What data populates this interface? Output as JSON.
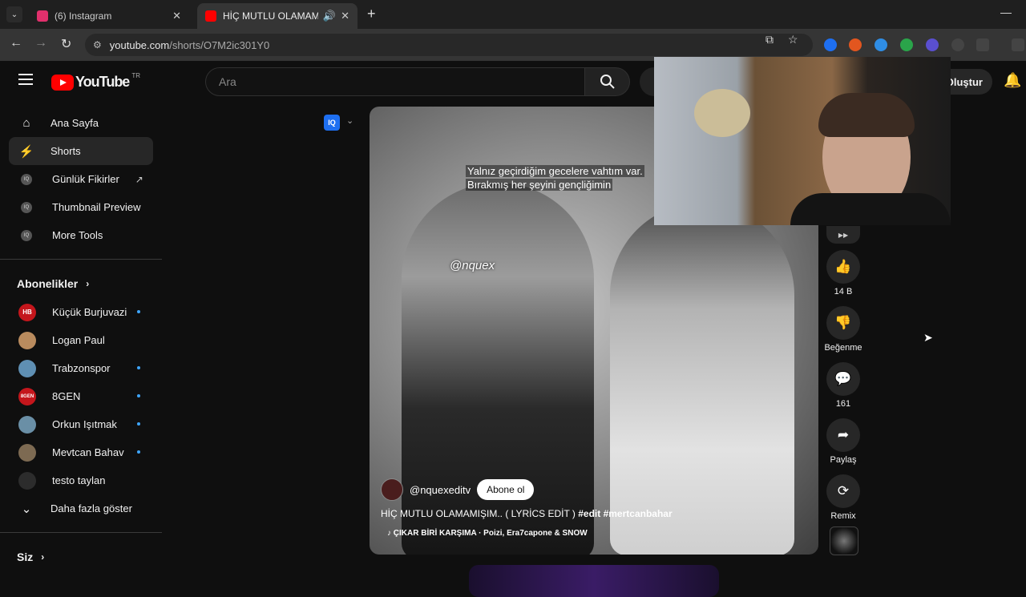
{
  "browser": {
    "tabs": [
      {
        "title": "(6) Instagram",
        "active": false,
        "favicon_color": "#e1306c"
      },
      {
        "title": "HİÇ MUTLU OLAMAMIŞIM..",
        "active": true,
        "favicon_color": "#ff0000"
      }
    ],
    "url_host": "youtube.com",
    "url_path": "/shorts/O7M2ic301Y0"
  },
  "header": {
    "logo_text": "YouTube",
    "country": "TR",
    "search_placeholder": "Ara",
    "create_label": "Oluştur"
  },
  "sidebar": {
    "main_items": [
      {
        "label": "Ana Sayfa",
        "icon": "home-icon"
      },
      {
        "label": "Shorts",
        "icon": "shorts-icon",
        "active": true
      },
      {
        "label": "Günlük Fikirler",
        "icon": "iq-icon",
        "external": true
      },
      {
        "label": "Thumbnail Preview",
        "icon": "iq-icon"
      },
      {
        "label": "More Tools",
        "icon": "iq-icon"
      }
    ],
    "subscriptions_title": "Abonelikler",
    "subscriptions": [
      {
        "label": "Küçük Burjuvazi",
        "avatar_text": "HB",
        "avatar_color": "#c4161c",
        "new": true
      },
      {
        "label": "Logan Paul",
        "avatar_text": "",
        "avatar_color": "#b98b5e",
        "new": false
      },
      {
        "label": "Trabzonspor",
        "avatar_text": "",
        "avatar_color": "#5f8fb3",
        "new": true
      },
      {
        "label": "8GEN",
        "avatar_text": "8GEN",
        "avatar_color": "#c4161c",
        "new": true
      },
      {
        "label": "Orkun Işıtmak",
        "avatar_text": "",
        "avatar_color": "#6a8fa6",
        "new": true
      },
      {
        "label": "Mevtcan Bahav",
        "avatar_text": "",
        "avatar_color": "#7d6a52",
        "new": true
      },
      {
        "label": "testo taylan",
        "avatar_text": "",
        "avatar_color": "#2c2c2c",
        "new": false
      }
    ],
    "show_more_label": "Daha fazla göster",
    "you_title": "Siz"
  },
  "short": {
    "lyric_line1": "Yalnız geçirdiğim gecelere vahtım var.",
    "lyric_line2": "Bırakmış her şeyini gençliğimin",
    "watermark": "@nquex",
    "channel": "@nquexeditv",
    "subscribe_label": "Abone ol",
    "title_plain": "HİÇ MUTLU OLAMAMIŞIM.. (  LYRİCS EDİT ) ",
    "title_tags": "#edit #mertcanbahar",
    "music": "ÇIKAR BİRİ KARŞIMA · Poizi, Era7capone & SNOW"
  },
  "actions": {
    "likes": "14 B",
    "dislike_label": "Beğenme",
    "comments": "161",
    "share_label": "Paylaş",
    "remix_label": "Remix"
  },
  "iq_badge": "IQ"
}
